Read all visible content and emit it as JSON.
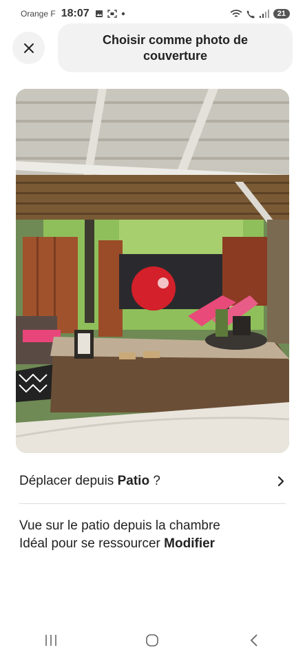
{
  "status_bar": {
    "carrier": "Orange F",
    "time": "18:07",
    "battery_level": "21"
  },
  "header": {
    "title": "Choisir comme photo de couverture"
  },
  "photo": {
    "description_icon": "patio-photo"
  },
  "move_row": {
    "prefix": "Déplacer depuis ",
    "room": "Patio",
    "suffix": " ?"
  },
  "caption": {
    "line1": "Vue sur le patio depuis la chambre",
    "line2": "Idéal pour se ressourcer ",
    "edit_label": "Modifier"
  },
  "colors": {
    "pill_bg": "#f2f2f2",
    "text": "#222222",
    "divider": "#dddddd"
  }
}
